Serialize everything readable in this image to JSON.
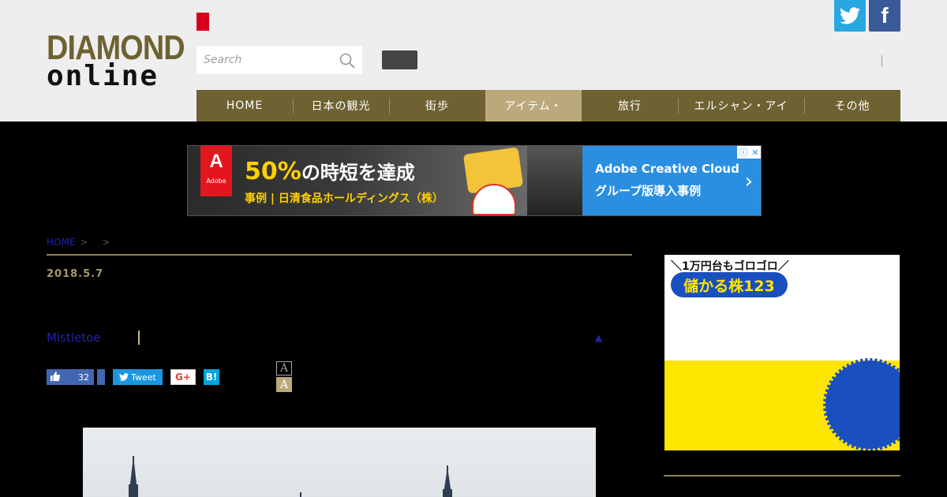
{
  "header": {
    "logo_line1": "DIAMOND",
    "logo_line2": "online",
    "search_placeholder": "Search",
    "separator": "|"
  },
  "social": {
    "twitter_icon": "twitter-icon",
    "facebook_glyph": "f"
  },
  "nav": {
    "items": [
      {
        "label": "HOME"
      },
      {
        "label": "日本の観光"
      },
      {
        "label": "街歩"
      },
      {
        "label": "アイテム・"
      },
      {
        "label": "旅行"
      },
      {
        "label": "エルシャン・アイ"
      },
      {
        "label": "その他"
      }
    ]
  },
  "ad": {
    "adobe_mark": "A",
    "adobe_text": "Adobe",
    "headline_num": "50%",
    "headline_rest": "の時短を達成",
    "sub": "事例 | 日清食品ホールディングス（株）",
    "right_line1": "Adobe Creative Cloud",
    "right_line2": "グループ版導入事例",
    "chevron": "›",
    "choices_i": "ⓘ",
    "choices_x": "✕"
  },
  "breadcrumb": {
    "home": "HOME",
    "sep1": ">",
    "sep2": ">"
  },
  "post": {
    "date": "2018.5.7",
    "author": "Mistletoe",
    "up_arrow": "▲"
  },
  "share": {
    "like_count": "32",
    "tweet_label": "Tweet",
    "gplus_label": "G+",
    "hatena_label": "B!"
  },
  "font_size": {
    "small": "A",
    "large": "A"
  },
  "side_ad": {
    "line1": "＼1万円台もゴロゴロ／",
    "pill": "儲かる株123"
  },
  "colors": {
    "brand_olive": "#6e6232",
    "nav_active": "#bba97c",
    "twitter": "#29a7e1",
    "facebook": "#3b5998"
  }
}
